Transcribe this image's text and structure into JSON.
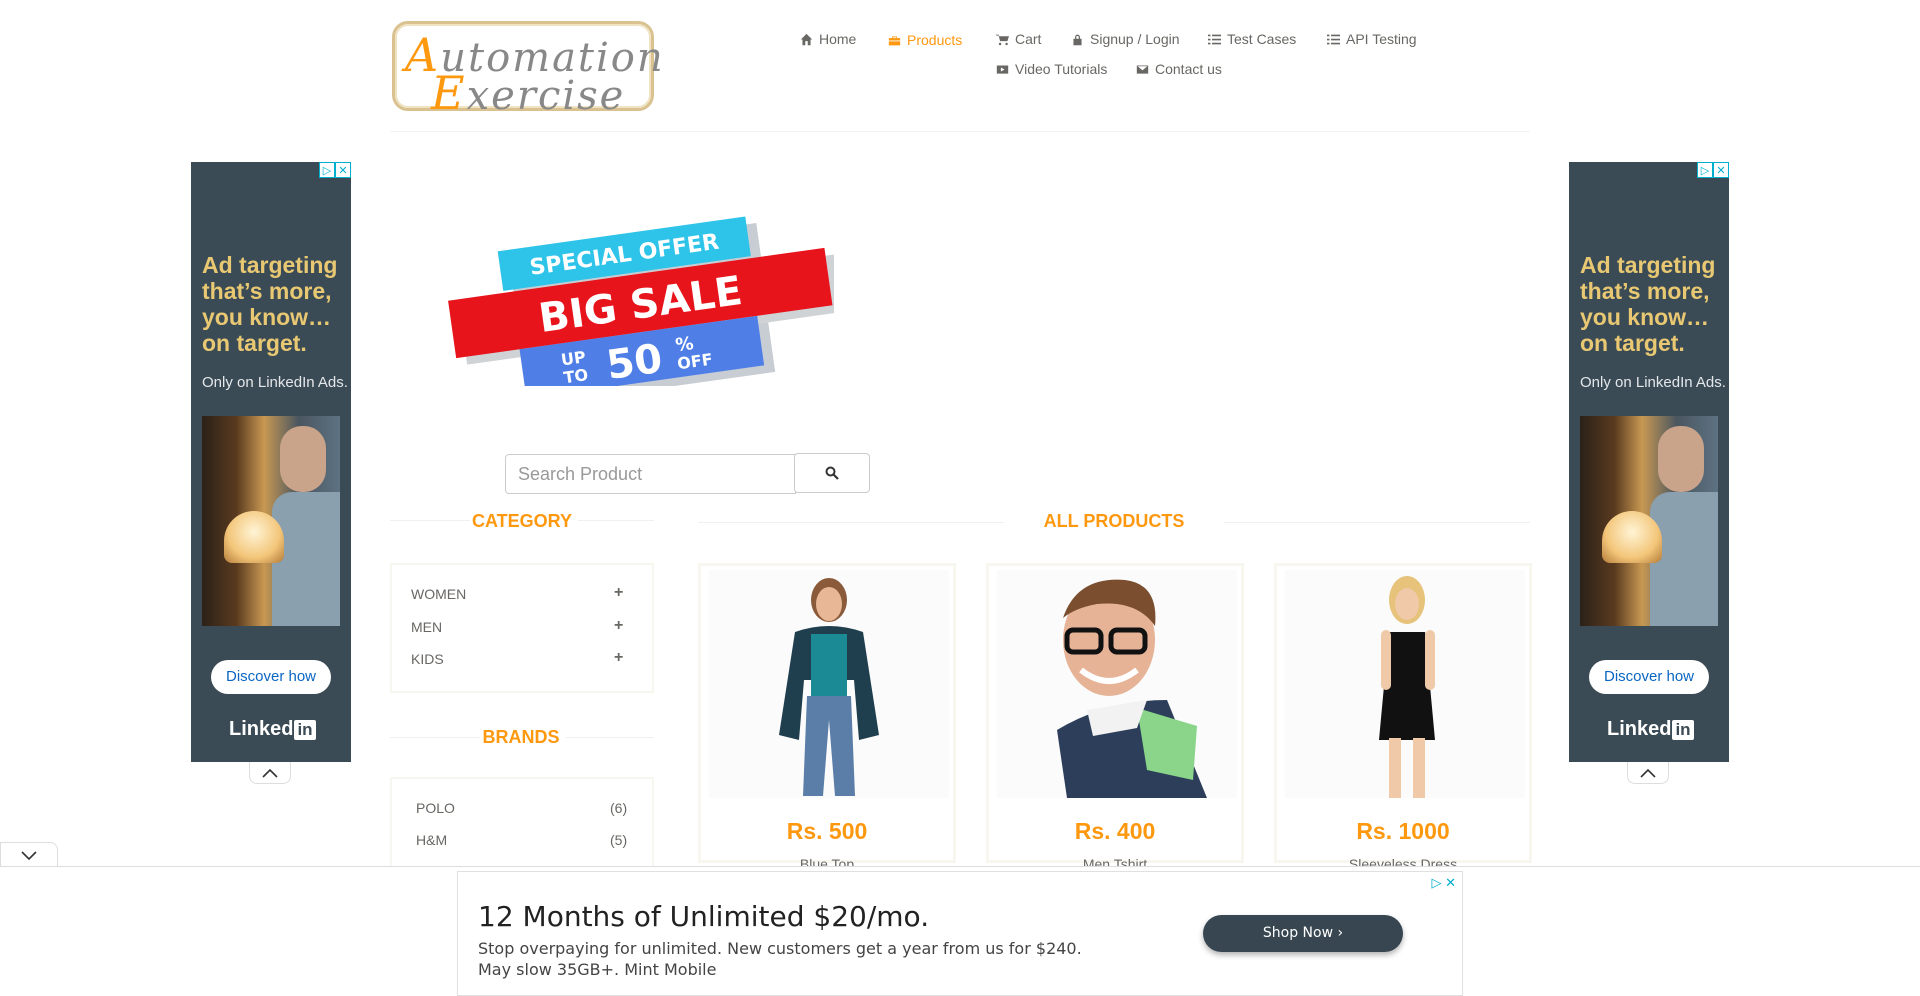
{
  "logo": {
    "line1_first": "A",
    "line1_rest": "utomation",
    "line2_first": "E",
    "line2_rest": "xercise"
  },
  "nav": {
    "home": "Home",
    "products": "Products",
    "cart": "Cart",
    "signup": "Signup / Login",
    "test_cases": "Test Cases",
    "api_testing": "API Testing",
    "video_tutorials": "Video Tutorials",
    "contact": "Contact us"
  },
  "side_ad": {
    "headline": "Ad targeting that’s more, you know… on target.",
    "sub": "Only on LinkedIn Ads.",
    "button": "Discover how",
    "brand_text": "Linked",
    "brand_box": "in"
  },
  "banner": {
    "line1": "SPECIAL OFFER",
    "line2": "BIG SALE",
    "up": "UP",
    "to": "TO",
    "pct": "50",
    "pct_sign": "%",
    "off": "OFF"
  },
  "search": {
    "placeholder": "Search Product"
  },
  "category": {
    "title": "CATEGORY",
    "items": [
      {
        "label": "WOMEN"
      },
      {
        "label": "MEN"
      },
      {
        "label": "KIDS"
      }
    ]
  },
  "brands": {
    "title": "BRANDS",
    "items": [
      {
        "label": "POLO",
        "count": "(6)"
      },
      {
        "label": "H&M",
        "count": "(5)"
      }
    ]
  },
  "products": {
    "title": "ALL PRODUCTS",
    "items": [
      {
        "price": "Rs. 500",
        "name": "Blue Top"
      },
      {
        "price": "Rs. 400",
        "name": "Men Tshirt"
      },
      {
        "price": "Rs. 1000",
        "name": "Sleeveless Dress"
      }
    ]
  },
  "bottom_ad": {
    "title": "12 Months of Unlimited $20/mo.",
    "description": "Stop overpaying for unlimited. New customers get a year from us for $240. May slow 35GB+. Mint Mobile",
    "button": "Shop Now"
  },
  "colors": {
    "accent": "#FE980F",
    "text": "#696763",
    "ad_bg": "#3B4B55"
  }
}
